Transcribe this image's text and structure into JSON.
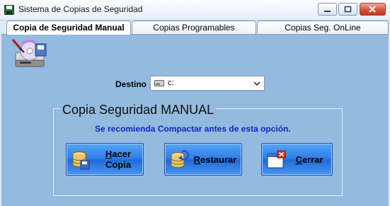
{
  "window": {
    "title": "Sistema de Copias de Seguridad"
  },
  "tabs": [
    {
      "label": "Copia de Seguridad Manual",
      "active": true
    },
    {
      "label": "Copias Programables",
      "active": false
    },
    {
      "label": "Copias Seg. OnLine",
      "active": false
    }
  ],
  "destino": {
    "label": "Destino",
    "value": "c:",
    "icon": "drive-icon"
  },
  "group": {
    "title": "Copia Seguridad MANUAL",
    "hint": "Se recomienda Compactar antes de esta opción."
  },
  "buttons": {
    "hacer": {
      "line1_mnemonic": "H",
      "line1_rest": "acer",
      "line2": "Copia",
      "icon": "database-disk-icon"
    },
    "restaurar": {
      "mnemonic": "R",
      "rest": "estaurar",
      "icon": "database-restore-icon"
    },
    "cerrar": {
      "mnemonic": "C",
      "rest": "errar",
      "icon": "close-window-icon"
    }
  },
  "colors": {
    "panel": "#94badf",
    "button": "#2d7de8",
    "hint_text": "#0a29c4",
    "close_red": "#c1371f"
  }
}
